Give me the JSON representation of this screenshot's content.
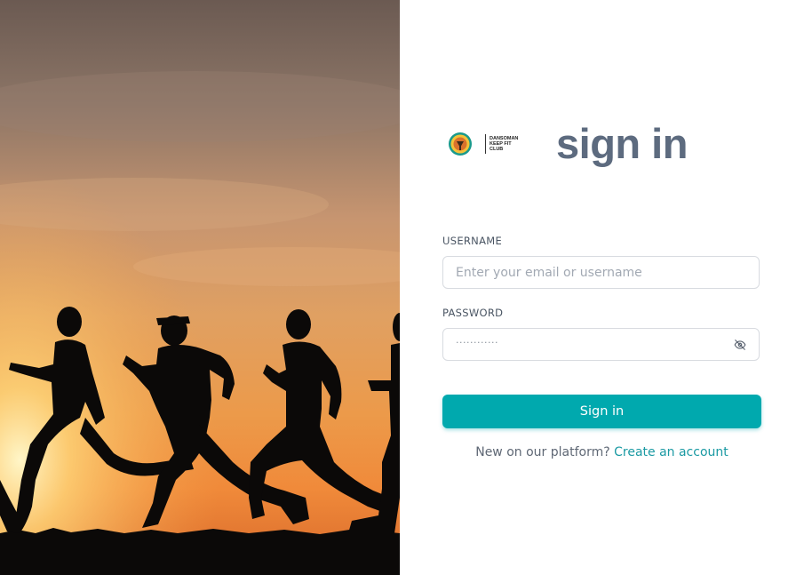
{
  "brand": {
    "club_name": "DANSOMAN KEEP FIT CLUB",
    "logo_icon": "club-logo-icon"
  },
  "title": "sign in",
  "form": {
    "username_label": "USERNAME",
    "username_placeholder": "Enter your email or username",
    "password_label": "PASSWORD",
    "password_value": "············",
    "toggle_icon": "eye-off-icon",
    "submit_label": "Sign in"
  },
  "footer": {
    "prompt": "New on our platform?",
    "link": "Create an account"
  },
  "colors": {
    "accent": "#00a9ae",
    "title": "#5d6b7f",
    "link": "#1b9aa3"
  }
}
